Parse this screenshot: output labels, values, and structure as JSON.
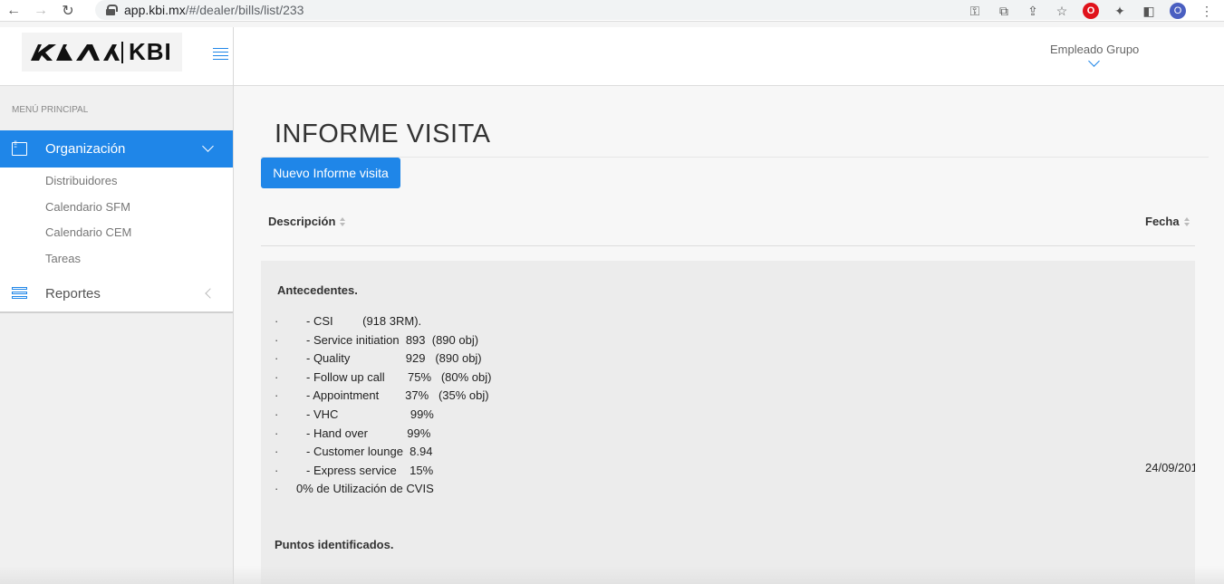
{
  "browser": {
    "url_host": "app.kbi.mx",
    "url_path": "/#/dealer/bills/list/233",
    "avatar_letter": "O",
    "opera_letter": "O"
  },
  "sidebar": {
    "logo_text": "KBI",
    "menu_header": "MENÚ PRINCIPAL",
    "active_item": {
      "label": "Organización",
      "icon": "sliders-icon"
    },
    "subitems": [
      "Distribuidores",
      "Calendario SFM",
      "Calendario CEM",
      "Tareas"
    ],
    "item2": {
      "label": "Reportes",
      "icon": "list-icon"
    }
  },
  "header": {
    "user": "Empleado Grupo"
  },
  "main": {
    "title": "INFORME VISITA",
    "new_button": "Nuevo Informe visita",
    "columns": {
      "description": "Descripción",
      "date": "Fecha"
    },
    "row": {
      "heading1": "Antecedentes.",
      "lines": [
        "- CSI         (918 3RM).",
        "- Service initiation  893  (890 obj)",
        "- Quality                 929   (890 obj)",
        "- Follow up call       75%   (80% obj)",
        "- Appointment        37%   (35% obj)",
        "- VHC                      99%",
        "- Hand over            99%",
        "- Customer lounge  8.94",
        "- Express service    15%"
      ],
      "last_line": "0% de Utilización de CVIS",
      "bullet": "·",
      "heading2": "Puntos identificados.",
      "date": "24/09/201"
    }
  },
  "colors": {
    "accent": "#1f86e8"
  }
}
